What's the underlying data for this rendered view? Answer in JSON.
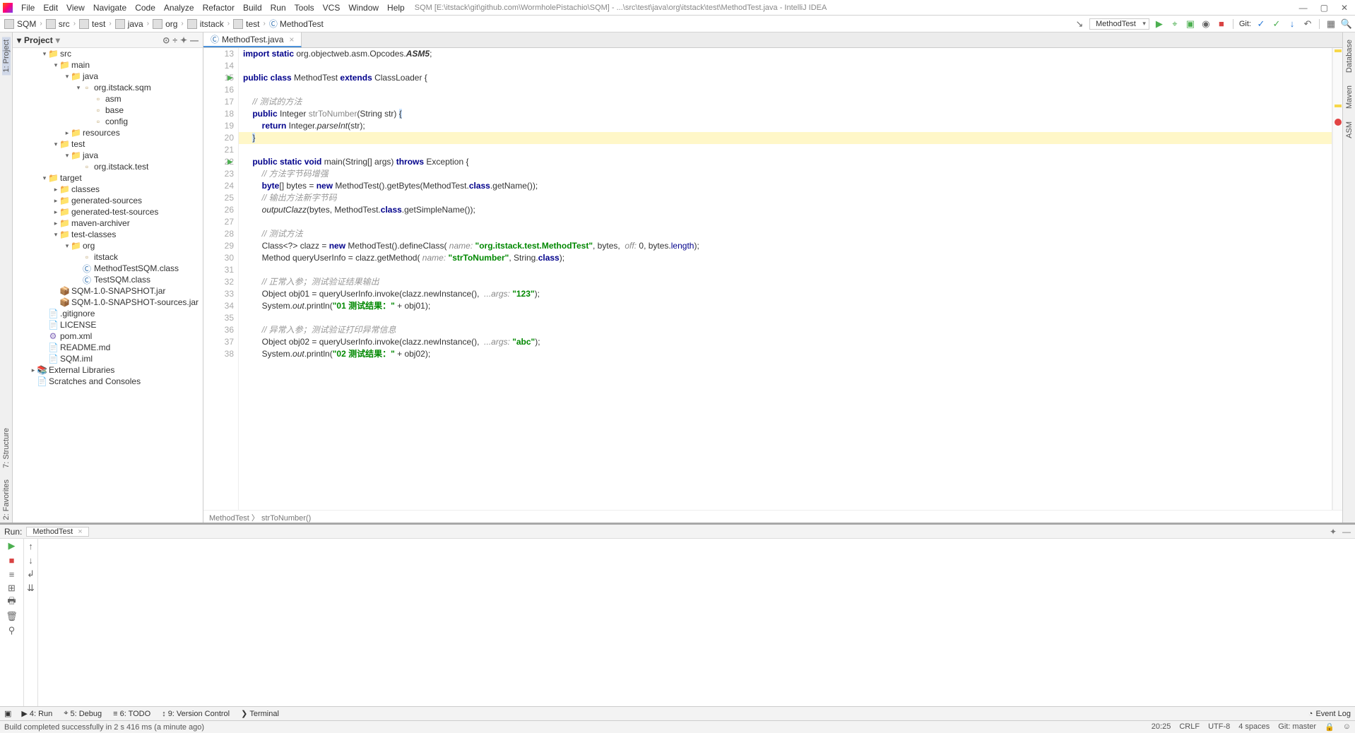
{
  "window": {
    "title": "SQM [E:\\itstack\\git\\github.com\\WormholePistachio\\SQM] - ...\\src\\test\\java\\org\\itstack\\test\\MethodTest.java - IntelliJ IDEA"
  },
  "menu": [
    "File",
    "Edit",
    "View",
    "Navigate",
    "Code",
    "Analyze",
    "Refactor",
    "Build",
    "Run",
    "Tools",
    "VCS",
    "Window",
    "Help"
  ],
  "breadcrumb": [
    "SQM",
    "src",
    "test",
    "java",
    "org",
    "itstack",
    "test",
    "MethodTest"
  ],
  "run_config": "MethodTest",
  "git_label": "Git:",
  "project_panel": {
    "title": "Project"
  },
  "tree": [
    {
      "d": 0,
      "t": "v",
      "i": "folder",
      "n": "src"
    },
    {
      "d": 1,
      "t": "v",
      "i": "folder",
      "n": "main"
    },
    {
      "d": 2,
      "t": "v",
      "i": "folder",
      "n": "java"
    },
    {
      "d": 3,
      "t": "v",
      "i": "pkg",
      "n": "org.itstack.sqm"
    },
    {
      "d": 4,
      "t": " ",
      "i": "pkg",
      "n": "asm"
    },
    {
      "d": 4,
      "t": " ",
      "i": "pkg",
      "n": "base"
    },
    {
      "d": 4,
      "t": " ",
      "i": "pkg",
      "n": "config"
    },
    {
      "d": 2,
      "t": ">",
      "i": "folder",
      "n": "resources"
    },
    {
      "d": 1,
      "t": "v",
      "i": "folder",
      "n": "test"
    },
    {
      "d": 2,
      "t": "v",
      "i": "folder",
      "n": "java"
    },
    {
      "d": 3,
      "t": " ",
      "i": "pkg",
      "n": "org.itstack.test"
    },
    {
      "d": 0,
      "t": "v",
      "i": "folder",
      "n": "target"
    },
    {
      "d": 1,
      "t": ">",
      "i": "folder",
      "n": "classes"
    },
    {
      "d": 1,
      "t": ">",
      "i": "folder",
      "n": "generated-sources"
    },
    {
      "d": 1,
      "t": ">",
      "i": "folder",
      "n": "generated-test-sources"
    },
    {
      "d": 1,
      "t": ">",
      "i": "folder",
      "n": "maven-archiver"
    },
    {
      "d": 1,
      "t": "v",
      "i": "folder",
      "n": "test-classes"
    },
    {
      "d": 2,
      "t": "v",
      "i": "folder",
      "n": "org"
    },
    {
      "d": 3,
      "t": " ",
      "i": "pkg",
      "n": "itstack"
    },
    {
      "d": 3,
      "t": " ",
      "i": "class",
      "n": "MethodTestSQM.class"
    },
    {
      "d": 3,
      "t": " ",
      "i": "class",
      "n": "TestSQM.class"
    },
    {
      "d": 1,
      "t": " ",
      "i": "jar",
      "n": "SQM-1.0-SNAPSHOT.jar"
    },
    {
      "d": 1,
      "t": " ",
      "i": "jar",
      "n": "SQM-1.0-SNAPSHOT-sources.jar"
    },
    {
      "d": 0,
      "t": " ",
      "i": "file",
      "n": ".gitignore"
    },
    {
      "d": 0,
      "t": " ",
      "i": "file",
      "n": "LICENSE"
    },
    {
      "d": 0,
      "t": " ",
      "i": "xml",
      "n": "pom.xml"
    },
    {
      "d": 0,
      "t": " ",
      "i": "file",
      "n": "README.md"
    },
    {
      "d": 0,
      "t": " ",
      "i": "file",
      "n": "SQM.iml"
    },
    {
      "d": -1,
      "t": ">",
      "i": "lib",
      "n": "External Libraries"
    },
    {
      "d": -1,
      "t": " ",
      "i": "file",
      "n": "Scratches and Consoles"
    }
  ],
  "editor": {
    "tab": "MethodTest.java",
    "breadcrumb_mini": "MethodTest 〉 strToNumber()",
    "first_line_no": 13,
    "highlighted_line_index": 7,
    "run_markers": [
      15,
      22
    ],
    "code_html": [
      "<span class='kw'>import static</span> org.objectweb.asm.Opcodes.<span class='stat'><b>ASM5</b></span>;",
      "",
      "<span class='kw'>public class</span> MethodTest <span class='kw'>extends</span> ClassLoader {",
      "",
      "    <span class='cmt'>// 测试的方法</span>",
      "    <span class='kw'>public</span> Integer <span style='color:#888'>strToNumber</span>(String str) <span class='sel-brace'>{</span>",
      "        <span class='kw'>return</span> Integer.<span class='stat'>parseInt</span>(str);",
      "    <span class='sel-brace'>}</span>",
      "",
      "    <span class='kw'>public static void</span> main(String[] args) <span class='kw'>throws</span> Exception {",
      "        <span class='cmt'>// 方法字节码增强</span>",
      "        <span class='kw'>byte</span>[] bytes = <span class='kw'>new</span> MethodTest().getBytes(MethodTest.<span class='kw'>class</span>.getName());",
      "        <span class='cmt'>// 输出方法新字节码</span>",
      "        <span class='stat'>outputClazz</span>(bytes, MethodTest.<span class='kw'>class</span>.getSimpleName());",
      "",
      "        <span class='cmt'>// 测试方法</span>",
      "        Class&lt;?&gt; clazz = <span class='kw'>new</span> MethodTest().defineClass( <span class='param'>name:</span> <span class='str'>\"org.itstack.test.MethodTest\"</span>, bytes,  <span class='param'>off:</span> 0, bytes.<span class='kw2'>length</span>);",
      "        Method queryUserInfo = clazz.getMethod( <span class='param'>name:</span> <span class='str'>\"strToNumber\"</span>, String.<span class='kw'>class</span>);",
      "",
      "        <span class='cmt'>// 正常入参；测试验证结果输出</span>",
      "        Object obj01 = queryUserInfo.invoke(clazz.newInstance(),  <span class='param'>...args:</span> <span class='str'>\"123\"</span>);",
      "        System.<span class='stat'>out</span>.println(<span class='str'>\"01 测试结果：\"</span> + obj01);",
      "",
      "        <span class='cmt'>// 异常入参；测试验证打印异常信息</span>",
      "        Object obj02 = queryUserInfo.invoke(clazz.newInstance(),  <span class='param'>...args:</span> <span class='str'>\"abc\"</span>);",
      "        System.<span class='stat'>out</span>.println(<span class='str'>\"02 测试结果：\"</span> + obj02);"
    ]
  },
  "run_panel": {
    "label": "Run:",
    "tab": "MethodTest"
  },
  "bottom_tabs": [
    {
      "icon": "▶",
      "label": "4: Run"
    },
    {
      "icon": "⌖",
      "label": "5: Debug"
    },
    {
      "icon": "≡",
      "label": "6: TODO"
    },
    {
      "icon": "↕",
      "label": "9: Version Control"
    },
    {
      "icon": "❯",
      "label": "Terminal"
    }
  ],
  "event_log": "Event Log",
  "status": {
    "msg": "Build completed successfully in 2 s 416 ms (a minute ago)",
    "pos": "20:25",
    "eol": "CRLF",
    "enc": "UTF-8",
    "indent": "4 spaces",
    "git": "Git: master"
  },
  "left_gutter": [
    "1: Project"
  ],
  "left_gutter_bottom": [
    "7: Structure",
    "2: Favorites"
  ],
  "right_gutter": [
    "Database",
    "Maven",
    "ASM"
  ]
}
